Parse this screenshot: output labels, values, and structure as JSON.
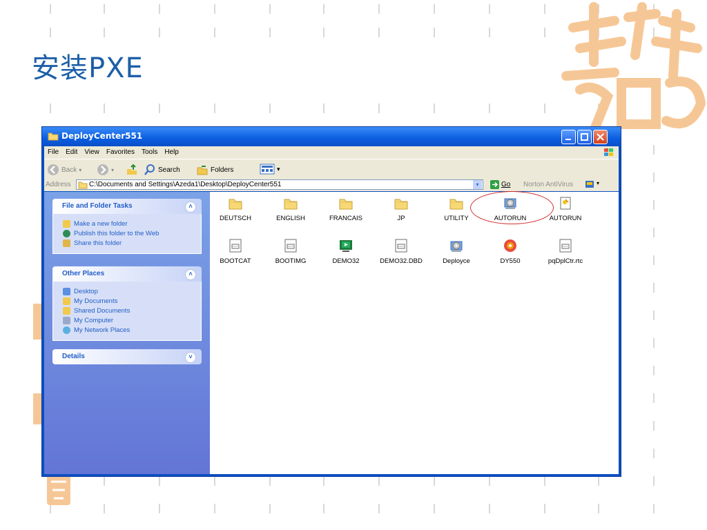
{
  "slide": {
    "title": "安装PXE"
  },
  "window": {
    "title": "DeployCenter551",
    "menu": [
      "File",
      "Edit",
      "View",
      "Favorites",
      "Tools",
      "Help"
    ],
    "toolbar": {
      "back": "Back",
      "search": "Search",
      "folders": "Folders"
    },
    "address": {
      "label": "Address",
      "value": "C:\\Documents and Settings\\Azeda1\\Desktop\\DeployCenter551",
      "go": "Go",
      "norton": "Norton AntiVirus"
    }
  },
  "taskpane": {
    "file_tasks": {
      "title": "File and Folder Tasks",
      "items": [
        "Make a new folder",
        "Publish this folder to the Web",
        "Share this folder"
      ]
    },
    "other_places": {
      "title": "Other Places",
      "items": [
        "Desktop",
        "My Documents",
        "Shared Documents",
        "My Computer",
        "My Network Places"
      ]
    },
    "details": {
      "title": "Details"
    }
  },
  "files": [
    {
      "name": "DEUTSCH",
      "icon": "folder-icon"
    },
    {
      "name": "ENGLISH",
      "icon": "folder-icon"
    },
    {
      "name": "FRANCAIS",
      "icon": "folder-icon"
    },
    {
      "name": "JP",
      "icon": "folder-icon"
    },
    {
      "name": "UTILITY",
      "icon": "folder-icon"
    },
    {
      "name": "AUTORUN",
      "icon": "disc-setup-icon"
    },
    {
      "name": "AUTORUN",
      "icon": "setup-info-icon"
    },
    {
      "name": "BOOTCAT",
      "icon": "file-icon"
    },
    {
      "name": "BOOTIMG",
      "icon": "file-icon"
    },
    {
      "name": "DEMO32",
      "icon": "video-icon"
    },
    {
      "name": "DEMO32.DBD",
      "icon": "file-icon"
    },
    {
      "name": "Deployce",
      "icon": "disc-setup-icon"
    },
    {
      "name": "DY550",
      "icon": "cd-icon"
    },
    {
      "name": "pqDplCtr.rtc",
      "icon": "file-icon"
    }
  ],
  "colors": {
    "title": "#1d5fa8",
    "seal": "#f6c796",
    "highlight": "#d42a2a"
  }
}
